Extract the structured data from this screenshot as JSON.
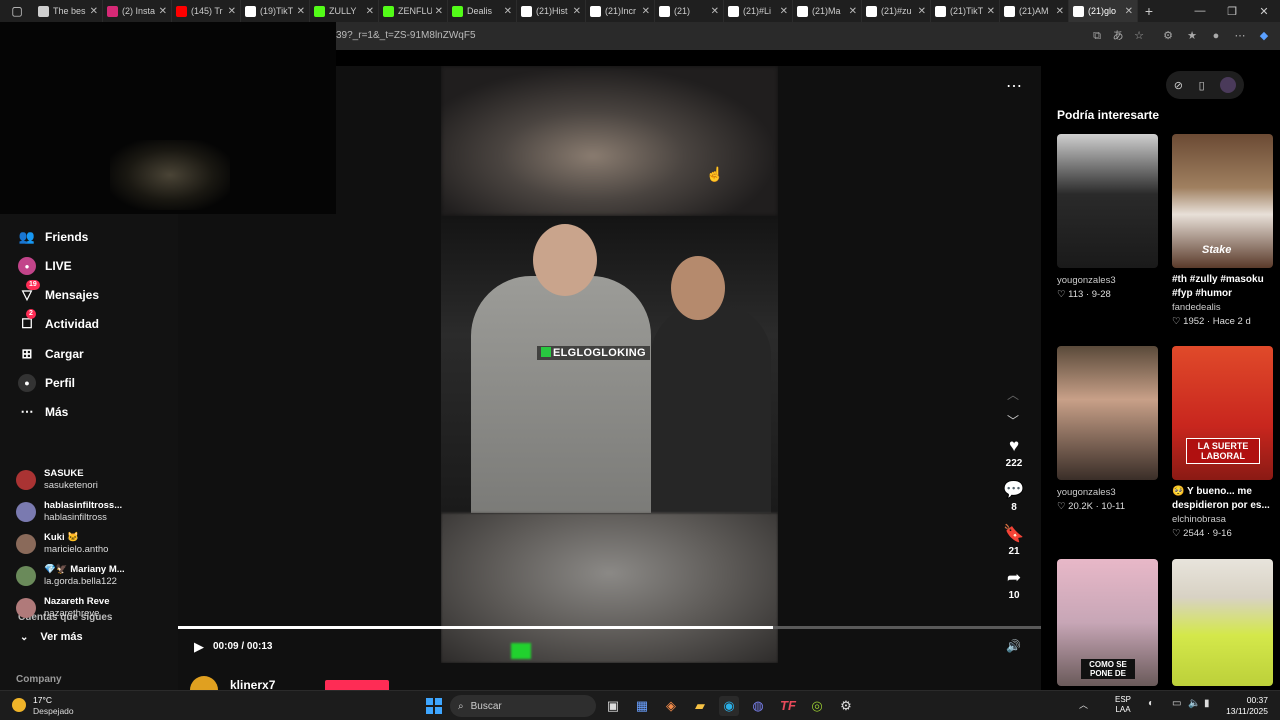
{
  "browser": {
    "tabs": [
      {
        "title": "The bes",
        "icon": "gem-icon",
        "color": "#cfcfcf"
      },
      {
        "title": "(2) Insta",
        "icon": "instagram-icon",
        "color": "#d62976"
      },
      {
        "title": "(145) Tr",
        "icon": "youtube-icon",
        "color": "#ff0000"
      },
      {
        "title": "(19)TikT",
        "icon": "tiktok-icon",
        "color": "#ffffff"
      },
      {
        "title": "ZULLY",
        "icon": "kick-icon",
        "color": "#53fc18"
      },
      {
        "title": "ZENFLU",
        "icon": "kick-icon",
        "color": "#53fc18"
      },
      {
        "title": "Dealis",
        "icon": "kick-icon",
        "color": "#53fc18"
      },
      {
        "title": "(21)Hist",
        "icon": "tiktok-icon",
        "color": "#ffffff"
      },
      {
        "title": "(21)Incr",
        "icon": "tiktok-icon",
        "color": "#ffffff"
      },
      {
        "title": "(21)",
        "icon": "tiktok-icon",
        "color": "#ffffff"
      },
      {
        "title": "(21)#Li",
        "icon": "tiktok-icon",
        "color": "#ffffff"
      },
      {
        "title": "(21)Ma",
        "icon": "tiktok-icon",
        "color": "#ffffff"
      },
      {
        "title": "(21)#zu",
        "icon": "tiktok-icon",
        "color": "#ffffff"
      },
      {
        "title": "(21)TikT",
        "icon": "tiktok-icon",
        "color": "#ffffff"
      },
      {
        "title": "(21)AM",
        "icon": "tiktok-icon",
        "color": "#ffffff"
      },
      {
        "title": "(21)glo",
        "icon": "tiktok-icon",
        "color": "#ffffff",
        "active": true
      }
    ],
    "url": "39?_r=1&_t=ZS-91M8lnZWqF5"
  },
  "sidebar": {
    "nav": [
      {
        "label": "Friends",
        "icon": "friends-icon"
      },
      {
        "label": "LIVE",
        "icon": "live-icon"
      },
      {
        "label": "Mensajes",
        "icon": "messages-icon",
        "badge": "19"
      },
      {
        "label": "Actividad",
        "icon": "activity-icon",
        "badge": "2"
      },
      {
        "label": "Cargar",
        "icon": "upload-icon"
      },
      {
        "label": "Perfil",
        "icon": "profile-icon"
      },
      {
        "label": "Más",
        "icon": "more-icon"
      }
    ],
    "following_title": "Cuentas que sigues",
    "accounts": [
      {
        "name": "SASUKE",
        "user": "sasuketenori",
        "color": "#a33"
      },
      {
        "name": "hablasinfiltross...",
        "user": "hablasinfiltross",
        "color": "#7a7ab0"
      },
      {
        "name": "Kuki 🐱",
        "user": "maricielo.antho",
        "color": "#8a6a5a"
      },
      {
        "name": "💎🦅 Mariany M...",
        "user": "la.gorda.bella122",
        "color": "#6a8a5a"
      },
      {
        "name": "Nazareth Reve",
        "user": "nazarethreve",
        "color": "#b07a7a"
      }
    ],
    "see_more": "Ver más",
    "company": "Company"
  },
  "video": {
    "caption": "ELGLOGLOKING",
    "progress": 0.69,
    "time": "00:09 / 00:13",
    "likes": "222",
    "comments": "8",
    "saves": "21",
    "shares": "10",
    "author": "klinerx7"
  },
  "recs": {
    "title": "Podría interesarte",
    "items": [
      {
        "desc": "",
        "user": "yougonzales3",
        "meta": "♡ 113 · 9-28",
        "thumb": "#2a2a2a",
        "label": ""
      },
      {
        "desc": "#th #zully #masoku #fyp #humor",
        "user": "fandedealis",
        "meta": "♡ 1952 · Hace 2 d",
        "thumb": "#5a3a2a",
        "label": "Stake"
      },
      {
        "desc": "",
        "user": "yougonzales3",
        "meta": "♡ 20.2K · 10-11",
        "thumb": "#3a2e28",
        "label": ""
      },
      {
        "desc": "🥺 Y bueno... me despidieron por es...",
        "user": "elchinobrasa",
        "meta": "♡ 2544 · 9-16",
        "thumb": "#c8261e",
        "label": "LA SUERTE LABORAL"
      },
      {
        "desc": "",
        "user": "",
        "meta": "",
        "thumb": "#c7a6b6",
        "label": "COMO SE PONE DE"
      },
      {
        "desc": "",
        "user": "",
        "meta": "",
        "thumb": "#d8d2c4",
        "label": ""
      }
    ]
  },
  "taskbar": {
    "temp": "17°C",
    "weather": "Despejado",
    "search": "Buscar",
    "lang_line1": "ESP",
    "lang_line2": "LAA",
    "time": "00:37",
    "date": "13/11/2025"
  }
}
